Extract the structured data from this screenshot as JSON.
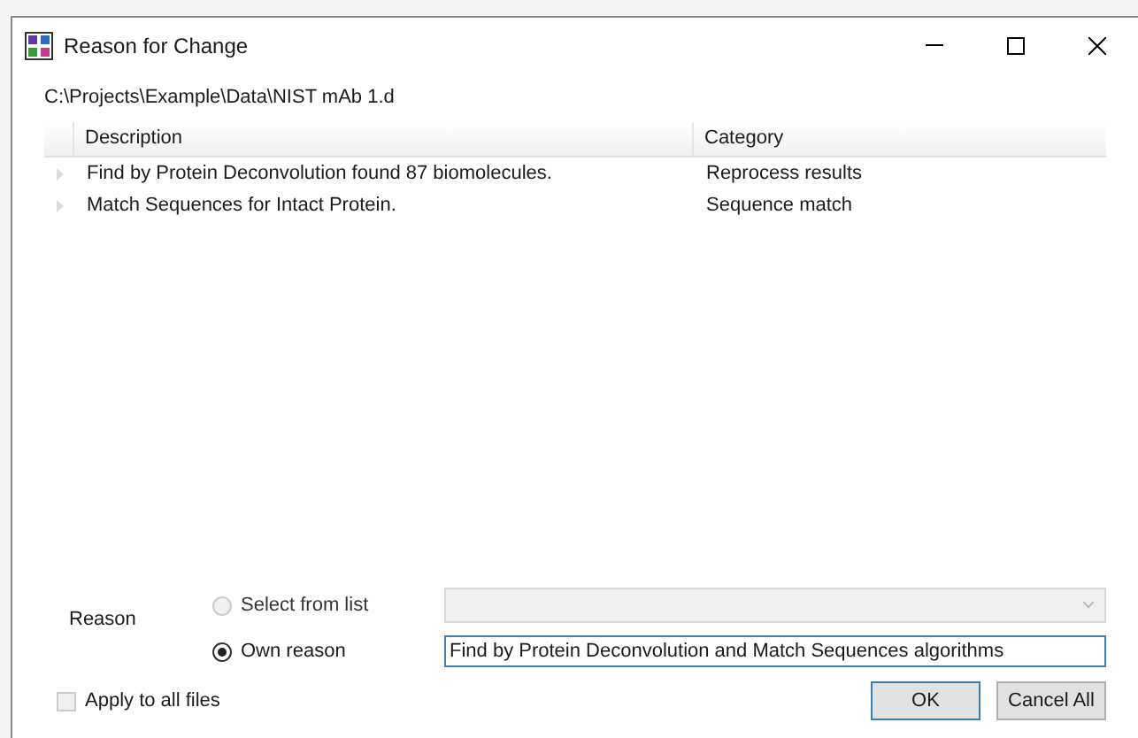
{
  "window": {
    "title": "Reason for Change"
  },
  "path": "C:\\Projects\\Example\\Data\\NIST mAb 1.d",
  "table": {
    "columns": [
      "Description",
      "Category"
    ],
    "rows": [
      {
        "description": "Find by Protein Deconvolution found 87 biomolecules.",
        "category": "Reprocess results"
      },
      {
        "description": "Match Sequences for Intact Protein.",
        "category": "Sequence match"
      }
    ]
  },
  "reason": {
    "label": "Reason",
    "options": [
      {
        "kind": "list",
        "label": "Select from list",
        "selected": false
      },
      {
        "kind": "text",
        "label": "Own reason",
        "selected": true,
        "value": "Find by Protein Deconvolution and Match Sequences algorithms"
      }
    ]
  },
  "apply_all": {
    "label": "Apply to all files",
    "checked": false
  },
  "buttons": [
    "OK",
    "Cancel All"
  ]
}
